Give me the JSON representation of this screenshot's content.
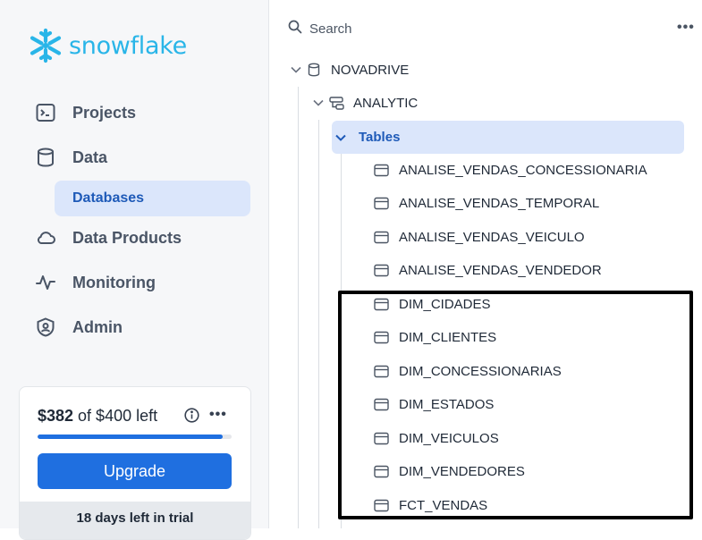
{
  "brand": {
    "name": "snowflake",
    "color": "#29b5e8"
  },
  "nav": {
    "items": [
      {
        "label": "Projects",
        "icon": "terminal-icon"
      },
      {
        "label": "Data",
        "icon": "database-icon"
      },
      {
        "label": "Data Products",
        "icon": "cloud-icon"
      },
      {
        "label": "Monitoring",
        "icon": "activity-icon"
      },
      {
        "label": "Admin",
        "icon": "shield-icon"
      }
    ],
    "sub_item": {
      "label": "Databases",
      "selected": true
    }
  },
  "trial": {
    "credit_amount": "$382",
    "credit_rest": " of $400 left",
    "credit_fraction": 0.955,
    "upgrade_label": "Upgrade",
    "days_left": "18 days left in trial"
  },
  "explorer": {
    "search_placeholder": "Search",
    "database": "NOVADRIVE",
    "schema": "ANALYTIC",
    "folder": "Tables",
    "tables": [
      "ANALISE_VENDAS_CONCESSIONARIA",
      "ANALISE_VENDAS_TEMPORAL",
      "ANALISE_VENDAS_VEICULO",
      "ANALISE_VENDAS_VENDEDOR",
      "DIM_CIDADES",
      "DIM_CLIENTES",
      "DIM_CONCESSIONARIAS",
      "DIM_ESTADOS",
      "DIM_VEICULOS",
      "DIM_VENDEDORES",
      "FCT_VENDAS"
    ]
  },
  "colors": {
    "accent": "#1f6fe0",
    "selected_bg": "#dbe6fb",
    "selected_text": "#1e5ab8"
  }
}
